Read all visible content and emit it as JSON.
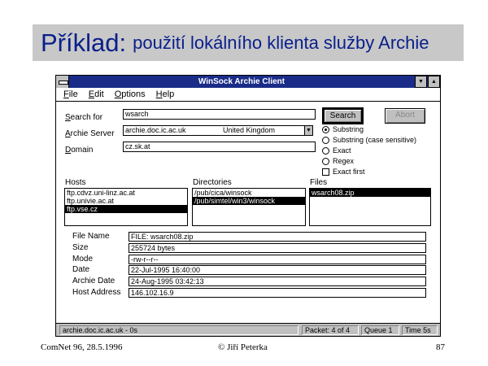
{
  "slide": {
    "title_main": "Příklad:",
    "title_sub": "použití lokálního klienta služby Archie"
  },
  "window": {
    "title": "WinSock Archie Client",
    "min_symbol": "▼",
    "max_symbol": "▲"
  },
  "menu": [
    "File",
    "Edit",
    "Options",
    "Help"
  ],
  "search": {
    "search_for_label": "Search for",
    "search_for_value": "wsarch",
    "archie_server_label": "Archie Server",
    "archie_server_value": "archie.doc.ic.ac.uk",
    "archie_server_country": "United Kingdom",
    "domain_label": "Domain",
    "domain_value": "cz.sk.at"
  },
  "buttons": {
    "search": "Search",
    "abort": "Abort"
  },
  "options": {
    "substring": "Substring",
    "substring_case": "Substring (case sensitive)",
    "exact": "Exact",
    "regex": "Regex",
    "exact_first": "Exact first"
  },
  "lists": {
    "hosts_label": "Hosts",
    "hosts": [
      "ftp.cdvz.uni-linz.ac.at",
      "ftp.univie.ac.at",
      "ftp.vse.cz"
    ],
    "directories_label": "Directories",
    "directories": [
      "/pub/cica/winsock",
      "/pub/simtel/win3/winsock"
    ],
    "files_label": "Files",
    "files": [
      "wsarch08.zip"
    ]
  },
  "details": {
    "file_name_label": "File Name",
    "file_name_value": "FILE: wsarch08.zip",
    "size_label": "Size",
    "size_value": "255724 bytes",
    "mode_label": "Mode",
    "mode_value": "-rw-r--r--",
    "date_label": "Date",
    "date_value": "22-Jul-1995 16:40:00",
    "archie_date_label": "Archie Date",
    "archie_date_value": "24-Aug-1995 03:42:13",
    "host_address_label": "Host Address",
    "host_address_value": "146.102.16.9"
  },
  "status": {
    "server": "archie.doc.ic.ac.uk - 0s",
    "packets": "Packet: 4 of 4",
    "queue": "Queue 1",
    "time": "Time 5s"
  },
  "footer": {
    "left": "ComNet 96, 28.5.1996",
    "center": "© Jiří Peterka",
    "right": "87"
  }
}
